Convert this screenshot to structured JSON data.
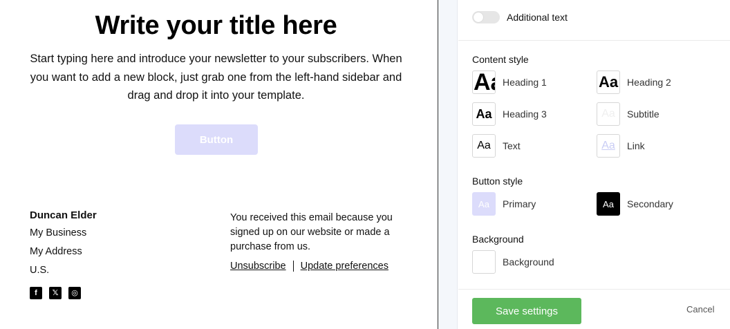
{
  "email": {
    "title": "Write your title here",
    "intro": "Start typing here and introduce your newsletter to your subscribers. When you want to add a new block, just grab one from the left-hand sidebar and drag and drop it into your template.",
    "button_label": "Button",
    "footer": {
      "name": "Duncan Elder",
      "lines": [
        "My Business",
        "My Address",
        "U.S."
      ],
      "social": [
        {
          "icon": "facebook-icon",
          "glyph": "f"
        },
        {
          "icon": "x-icon",
          "glyph": "𝕏"
        },
        {
          "icon": "instagram-icon",
          "glyph": "◎"
        }
      ],
      "note": "You received this email because you signed up on our website or made a purchase from us.",
      "unsubscribe": "Unsubscribe",
      "update_preferences": "Update preferences"
    }
  },
  "panel": {
    "additional_text_label": "Additional text",
    "content_style_title": "Content style",
    "content_styles": [
      {
        "swatch": "Aa",
        "label": "Heading 1"
      },
      {
        "swatch": "Aa",
        "label": "Heading 2"
      },
      {
        "swatch": "Aa",
        "label": "Heading 3"
      },
      {
        "swatch": "Aa",
        "label": "Subtitle"
      },
      {
        "swatch": "Aa",
        "label": "Text"
      },
      {
        "swatch": "Aa",
        "label": "Link"
      }
    ],
    "button_style_title": "Button style",
    "button_styles": [
      {
        "swatch": "Aa",
        "label": "Primary"
      },
      {
        "swatch": "Aa",
        "label": "Secondary"
      }
    ],
    "background_title": "Background",
    "background_item": {
      "label": "Background"
    },
    "save_label": "Save settings",
    "cancel_label": "Cancel"
  },
  "colors": {
    "primary_button": "#dcdcfb",
    "save_button": "#5cb85c",
    "secondary_button": "#000000"
  }
}
